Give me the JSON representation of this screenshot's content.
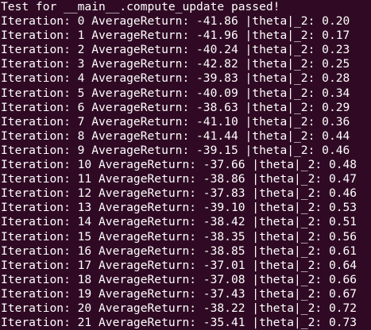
{
  "terminal": {
    "background": "#300a24",
    "foreground": "#ffffff",
    "lines": [
      "Test for __main__.compute_update passed!",
      "Iteration: 0 AverageReturn: -41.86 |theta|_2: 0.20",
      "Iteration: 1 AverageReturn: -41.96 |theta|_2: 0.17",
      "Iteration: 2 AverageReturn: -40.24 |theta|_2: 0.23",
      "Iteration: 3 AverageReturn: -42.82 |theta|_2: 0.25",
      "Iteration: 4 AverageReturn: -39.83 |theta|_2: 0.28",
      "Iteration: 5 AverageReturn: -40.09 |theta|_2: 0.34",
      "Iteration: 6 AverageReturn: -38.63 |theta|_2: 0.29",
      "Iteration: 7 AverageReturn: -41.10 |theta|_2: 0.36",
      "Iteration: 8 AverageReturn: -41.44 |theta|_2: 0.44",
      "Iteration: 9 AverageReturn: -39.15 |theta|_2: 0.46",
      "Iteration: 10 AverageReturn: -37.66 |theta|_2: 0.48",
      "Iteration: 11 AverageReturn: -38.86 |theta|_2: 0.47",
      "Iteration: 12 AverageReturn: -37.83 |theta|_2: 0.46",
      "Iteration: 13 AverageReturn: -39.10 |theta|_2: 0.53",
      "Iteration: 14 AverageReturn: -38.42 |theta|_2: 0.51",
      "Iteration: 15 AverageReturn: -38.35 |theta|_2: 0.56",
      "Iteration: 16 AverageReturn: -38.85 |theta|_2: 0.61",
      "Iteration: 17 AverageReturn: -37.01 |theta|_2: 0.64",
      "Iteration: 18 AverageReturn: -37.08 |theta|_2: 0.66",
      "Iteration: 19 AverageReturn: -37.43 |theta|_2: 0.67",
      "Iteration: 20 AverageReturn: -38.22 |theta|_2: 0.72",
      "Iteration: 21 AverageReturn: -35.41 |theta|_2: 0.73"
    ]
  }
}
